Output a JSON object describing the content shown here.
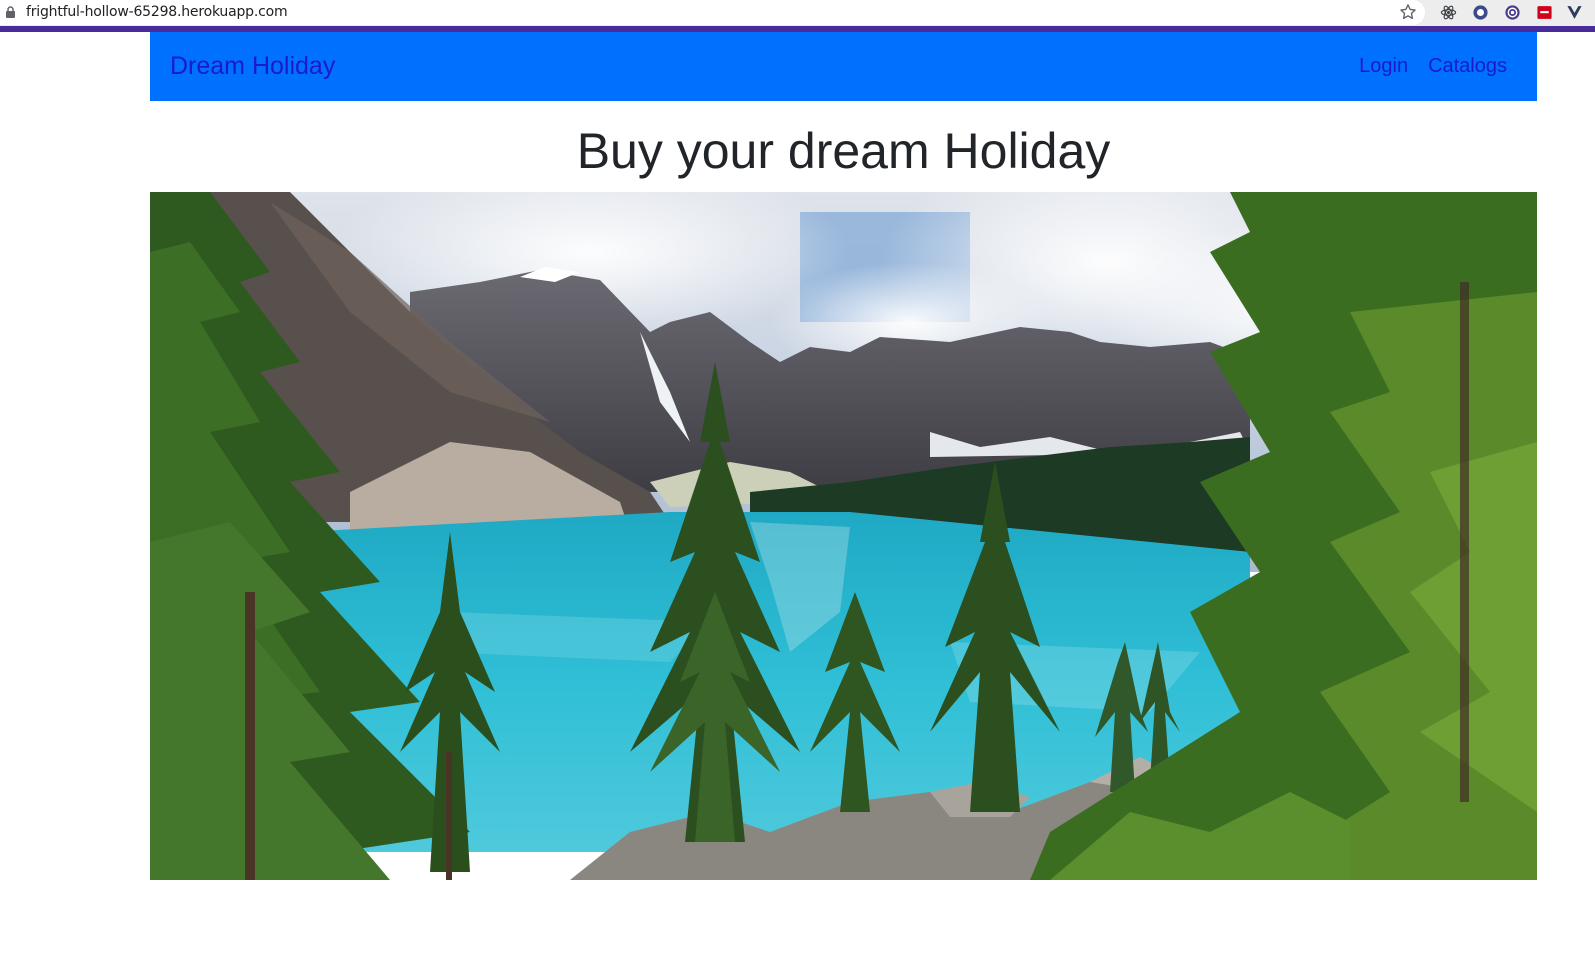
{
  "browser": {
    "url": "frightful-hollow-65298.herokuapp.com",
    "icons": [
      "lock-icon",
      "bookmark-star-icon",
      "react-devtools-icon",
      "extension-circle-icon",
      "extension-target-icon",
      "extension-red-icon",
      "vue-devtools-icon"
    ]
  },
  "navbar": {
    "brand": "Dream Holiday",
    "links": [
      "Login",
      "Catalogs"
    ],
    "background": "#0070ff",
    "link_color": "#1b1bc9"
  },
  "main": {
    "title": "Buy your dream Holiday",
    "hero_image": "mountain-lake-photo"
  }
}
